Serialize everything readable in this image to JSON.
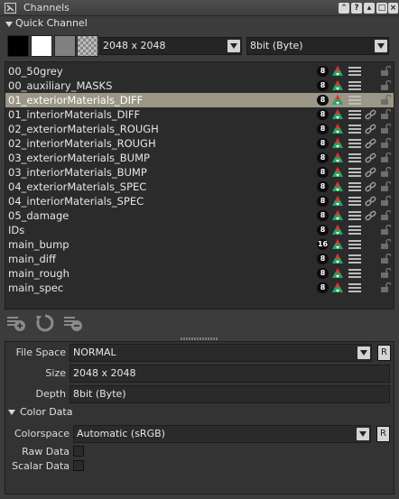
{
  "window": {
    "title": "Channels",
    "buttons": [
      "pin-icon",
      "help-icon",
      "float-icon",
      "close-icon"
    ]
  },
  "quick_channel": {
    "label": "Quick Channel",
    "swatches": [
      {
        "name": "black",
        "color": "#000000"
      },
      {
        "name": "white",
        "color": "#ffffff"
      },
      {
        "name": "grey",
        "color": "#808080"
      },
      {
        "name": "transparent",
        "color": "checker"
      }
    ],
    "size_value": "2048 x 2048",
    "depth_value": "8bit  (Byte)"
  },
  "channels": [
    {
      "name": "00_50grey",
      "bits": "8",
      "linked": false,
      "selected": false
    },
    {
      "name": "00_auxiliary_MASKS",
      "bits": "8",
      "linked": false,
      "selected": false
    },
    {
      "name": "01_exteriorMaterials_DIFF",
      "bits": "8",
      "linked": true,
      "selected": true
    },
    {
      "name": "01_interiorMaterials_DIFF",
      "bits": "8",
      "linked": true,
      "selected": false
    },
    {
      "name": "02_exteriorMaterials_ROUGH",
      "bits": "8",
      "linked": true,
      "selected": false
    },
    {
      "name": "02_interiorMaterials_ROUGH",
      "bits": "8",
      "linked": true,
      "selected": false
    },
    {
      "name": "03_exteriorMaterials_BUMP",
      "bits": "8",
      "linked": true,
      "selected": false
    },
    {
      "name": "03_interiorMaterials_BUMP",
      "bits": "8",
      "linked": true,
      "selected": false
    },
    {
      "name": "04_exteriorMaterials_SPEC",
      "bits": "8",
      "linked": true,
      "selected": false
    },
    {
      "name": "04_interiorMaterials_SPEC",
      "bits": "8",
      "linked": true,
      "selected": false
    },
    {
      "name": "05_damage",
      "bits": "8",
      "linked": true,
      "selected": false
    },
    {
      "name": "IDs",
      "bits": "8",
      "linked": false,
      "selected": false
    },
    {
      "name": "main_bump",
      "bits": "16",
      "linked": false,
      "selected": false
    },
    {
      "name": "main_diff",
      "bits": "8",
      "linked": false,
      "selected": false
    },
    {
      "name": "main_rough",
      "bits": "8",
      "linked": false,
      "selected": false
    },
    {
      "name": "main_spec",
      "bits": "8",
      "linked": false,
      "selected": false
    }
  ],
  "toolbar": [
    "new-channel-icon",
    "refresh-icon",
    "delete-channel-icon"
  ],
  "properties": {
    "file_space_label": "File Space",
    "file_space_value": "NORMAL",
    "size_label": "Size",
    "size_value": "2048 x 2048",
    "depth_label": "Depth",
    "depth_value": "8bit  (Byte)",
    "reset_label": "R"
  },
  "color_data": {
    "label": "Color Data",
    "colorspace_label": "Colorspace",
    "colorspace_value": "Automatic (sRGB)",
    "raw_data_label": "Raw Data",
    "raw_data_checked": false,
    "scalar_data_label": "Scalar Data",
    "scalar_data_checked": false,
    "reset_label": "R"
  },
  "colors": {
    "background": "#3c3c3c",
    "list_background": "#2b2b2b",
    "selection": "#9b9686",
    "text": "#e6e6e6"
  }
}
